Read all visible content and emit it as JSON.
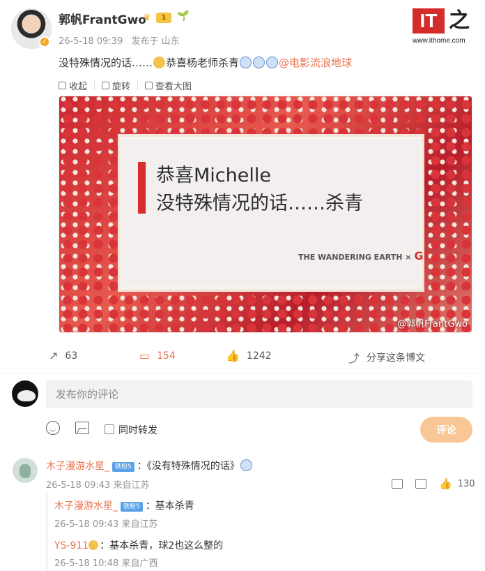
{
  "post": {
    "author": "郭帆FrantGwo",
    "vip_level": "1",
    "timestamp": "26-5-18 09:39",
    "location": "发布于 山东",
    "text_before": "没特殊情况的话……",
    "text_middle": "恭喜杨老师杀青",
    "mention": "@电影流浪地球",
    "toolbar": {
      "collect": "收起",
      "rotate": "旋转",
      "view_large": "查看大图"
    },
    "image": {
      "line1": "恭喜Michelle",
      "line2": "没特殊情况的话……杀青",
      "brand": "THE WANDERING EARTH",
      "brand_x": "×",
      "brand_g": "G!",
      "watermark": "@郭帆FrantGwo"
    },
    "actions": {
      "repost_count": "63",
      "comment_count": "154",
      "like_count": "1242",
      "share_label": "分享这条博文"
    }
  },
  "logo": {
    "it": "IT",
    "char": "之",
    "url": "www.ithome.com"
  },
  "composer": {
    "placeholder": "发布你的评论",
    "repost_label": "同时转发",
    "submit": "评论"
  },
  "comments": {
    "main": {
      "user": "木子漫游水星_",
      "badge": "铁粉5",
      "text": "：《没有特殊情况的话》",
      "meta": "26-5-18 09:43 来自江苏",
      "like_count": "130"
    },
    "replies": [
      {
        "user": "木子漫游水星_",
        "badge": "铁粉5",
        "text": "：基本杀青",
        "meta": "26-5-18 09:43 来自江苏"
      },
      {
        "user": "YS-911",
        "text": "：基本杀青，球2也这么整的",
        "meta": "26-5-18 10:48 来自广西"
      }
    ]
  }
}
